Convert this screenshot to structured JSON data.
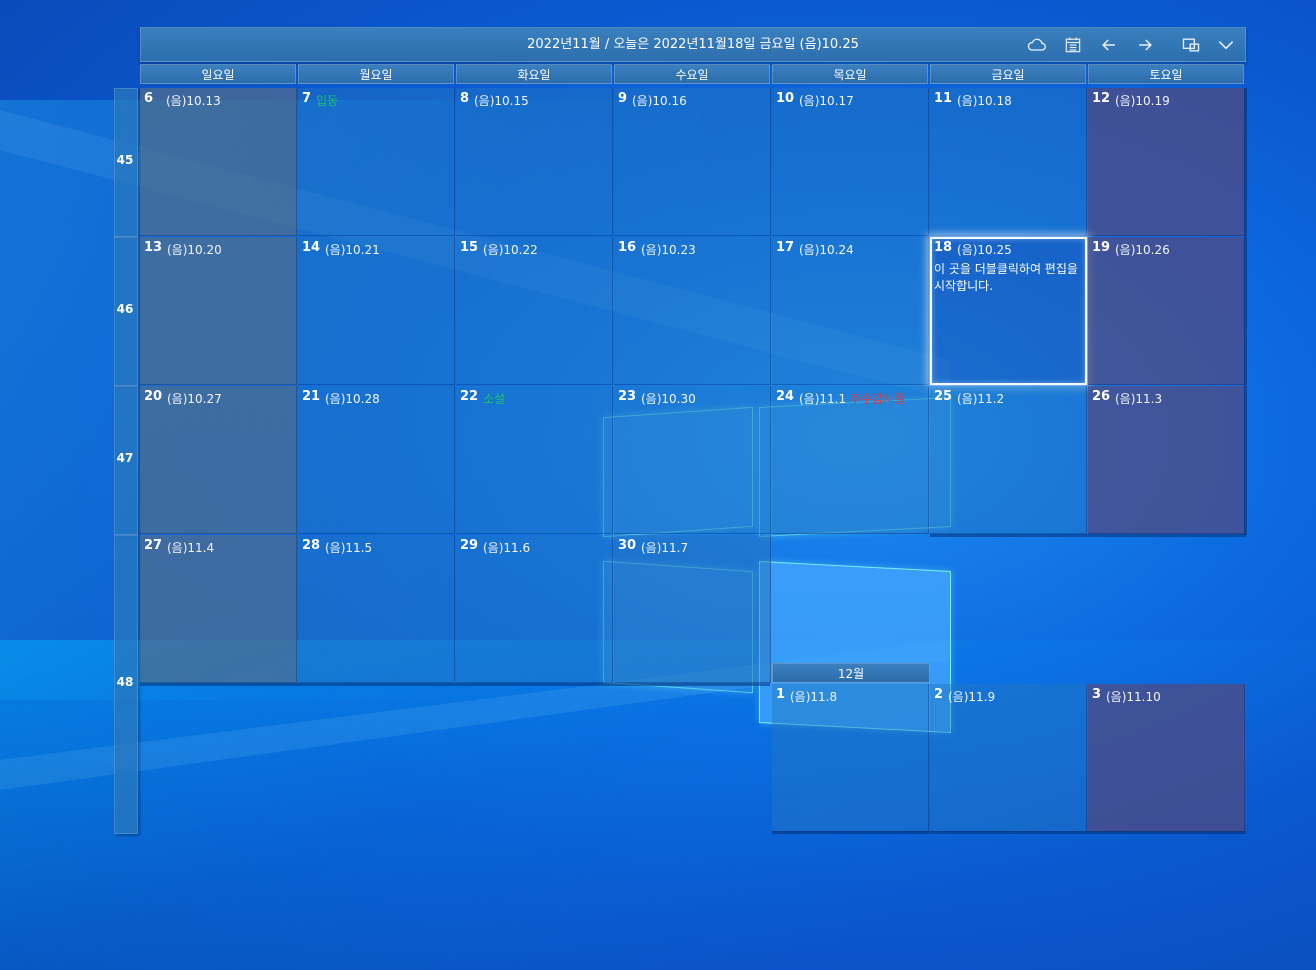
{
  "header": {
    "title": "2022년11월 / 오늘은 2022년11월18일 금요일 (음)10.25",
    "buttons": [
      {
        "name": "cloud-icon"
      },
      {
        "name": "calendar-icon"
      },
      {
        "name": "arrow-left-icon"
      },
      {
        "name": "arrow-right-icon"
      },
      {
        "name": "window-resize-icon"
      },
      {
        "name": "chevron-down-icon"
      }
    ]
  },
  "weekdays": [
    "일요일",
    "월요일",
    "화요일",
    "수요일",
    "목요일",
    "금요일",
    "토요일"
  ],
  "weeks": [
    "45",
    "46",
    "47",
    "48"
  ],
  "days": [
    {
      "day": "6",
      "lunar": "(음)10.13"
    },
    {
      "day": "7",
      "holiday": "입동"
    },
    {
      "day": "8",
      "lunar": "(음)10.15"
    },
    {
      "day": "9",
      "lunar": "(음)10.16"
    },
    {
      "day": "10",
      "lunar": "(음)10.17"
    },
    {
      "day": "11",
      "lunar": "(음)10.18"
    },
    {
      "day": "12",
      "lunar": "(음)10.19"
    },
    {
      "day": "13",
      "lunar": "(음)10.20"
    },
    {
      "day": "14",
      "lunar": "(음)10.21"
    },
    {
      "day": "15",
      "lunar": "(음)10.22"
    },
    {
      "day": "16",
      "lunar": "(음)10.23"
    },
    {
      "day": "17",
      "lunar": "(음)10.24"
    },
    {
      "day": "18",
      "lunar": "(음)10.25",
      "memo": "이 곳을 더블클릭하여 편집을 시작합니다."
    },
    {
      "day": "19",
      "lunar": "(음)10.26"
    },
    {
      "day": "20",
      "lunar": "(음)10.27"
    },
    {
      "day": "21",
      "lunar": "(음)10.28"
    },
    {
      "day": "22",
      "holiday": "소설"
    },
    {
      "day": "23",
      "lunar": "(음)10.30"
    },
    {
      "day": "24",
      "lunar": "(음)11.1",
      "event": "추수감사절"
    },
    {
      "day": "25",
      "lunar": "(음)11.2"
    },
    {
      "day": "26",
      "lunar": "(음)11.3"
    },
    {
      "day": "27",
      "lunar": "(음)11.4"
    },
    {
      "day": "28",
      "lunar": "(음)11.5"
    },
    {
      "day": "29",
      "lunar": "(음)11.6"
    },
    {
      "day": "30",
      "lunar": "(음)11.7"
    }
  ],
  "next_month": {
    "label": "12월",
    "days": [
      {
        "day": "1",
        "lunar": "(음)11.8"
      },
      {
        "day": "2",
        "lunar": "(음)11.9"
      },
      {
        "day": "3",
        "lunar": "(음)11.10"
      }
    ]
  },
  "colors": {
    "today_border": "#f4fbff",
    "holiday": "#18c46a",
    "event": "#e0394a",
    "sunday_cell": "#506e8c",
    "saturday_cell": "#504b82"
  }
}
